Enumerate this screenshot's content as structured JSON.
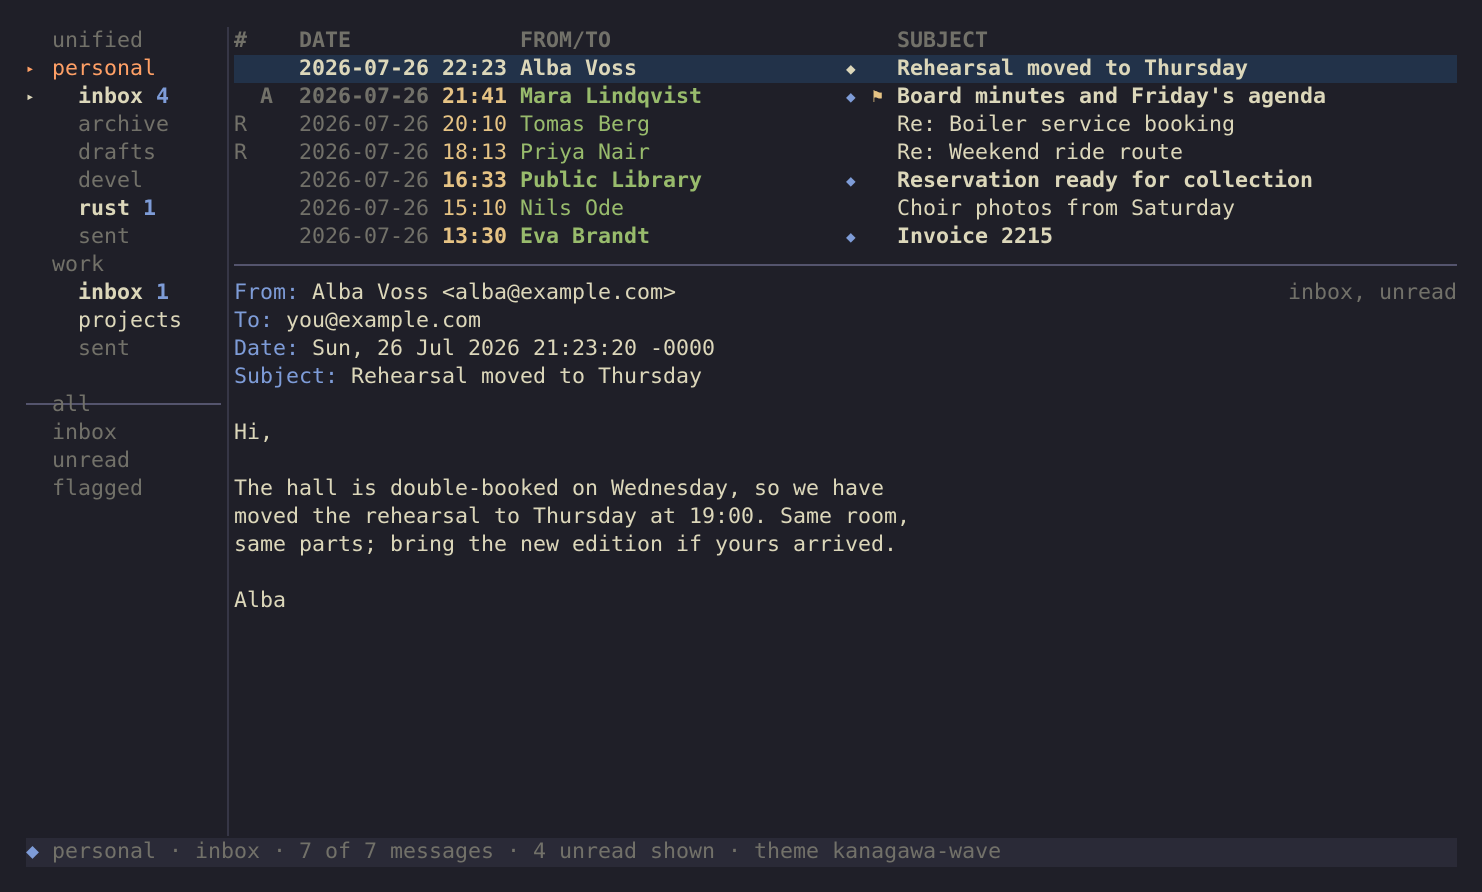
{
  "sidebar": {
    "unified": "unified",
    "accounts": [
      {
        "name": "personal",
        "arrow": "▸",
        "folders": [
          {
            "name": "inbox",
            "count": "4",
            "arrow": "▸"
          },
          {
            "name": "archive",
            "count": ""
          },
          {
            "name": "drafts",
            "count": ""
          },
          {
            "name": "devel",
            "count": ""
          },
          {
            "name": "rust",
            "count": "1"
          },
          {
            "name": "sent",
            "count": ""
          }
        ]
      },
      {
        "name": "work",
        "folders": [
          {
            "name": "inbox",
            "count": "1"
          },
          {
            "name": "projects",
            "count": ""
          },
          {
            "name": "sent",
            "count": ""
          }
        ]
      }
    ],
    "views": [
      "all",
      "inbox",
      "unread",
      "flagged"
    ]
  },
  "list": {
    "headers": {
      "num": "#",
      "date": "DATE",
      "from": "FROM/TO",
      "subject": "SUBJECT"
    },
    "rows": [
      {
        "mark": "",
        "date": "2026-07-26",
        "time": "22:23",
        "from": "Alba Voss",
        "unread_icon": "◆",
        "flag_icon": "",
        "subject": "Rehearsal moved to Thursday"
      },
      {
        "mark": "A",
        "date": "2026-07-26",
        "time": "21:41",
        "from": "Mara Lindqvist",
        "unread_icon": "◆",
        "flag_icon": "⚑",
        "subject": "Board minutes and Friday's agenda"
      },
      {
        "mark": "R",
        "date": "2026-07-26",
        "time": "20:10",
        "from": "Tomas Berg",
        "unread_icon": "",
        "flag_icon": "",
        "subject": "Re: Boiler service booking"
      },
      {
        "mark": "R",
        "date": "2026-07-26",
        "time": "18:13",
        "from": "Priya Nair",
        "unread_icon": "",
        "flag_icon": "",
        "subject": "Re: Weekend ride route"
      },
      {
        "mark": "",
        "date": "2026-07-26",
        "time": "16:33",
        "from": "Public Library",
        "unread_icon": "◆",
        "flag_icon": "",
        "subject": "Reservation ready for collection"
      },
      {
        "mark": "",
        "date": "2026-07-26",
        "time": "15:10",
        "from": "Nils Ode",
        "unread_icon": "",
        "flag_icon": "",
        "subject": "Choir photos from Saturday"
      },
      {
        "mark": "",
        "date": "2026-07-26",
        "time": "13:30",
        "from": "Eva Brandt",
        "unread_icon": "◆",
        "flag_icon": "",
        "subject": "Invoice 2215"
      }
    ]
  },
  "preview": {
    "tags": "inbox, unread",
    "from_label": "From:",
    "from": "Alba Voss <alba@example.com>",
    "to_label": "To:",
    "to": "you@example.com",
    "date_label": "Date:",
    "date": "Sun, 26 Jul 2026 21:23:20 -0000",
    "subject_label": "Subject:",
    "subject": "Rehearsal moved to Thursday",
    "body": [
      "",
      "Hi,",
      "",
      "The hall is double-booked on Wednesday, so we have",
      "moved the rehearsal to Thursday at 19:00. Same room,",
      "same parts; bring the new edition if yours arrived.",
      "",
      "Alba"
    ]
  },
  "status": {
    "icon": "◆",
    "text": "personal · inbox · 7 of 7 messages · 4 unread shown · theme kanagawa-wave"
  },
  "colors": {
    "background": "#1f1f28",
    "selected_row": "#223249",
    "accent_blue": "#7e9cd8",
    "accent_orange": "#ffa066",
    "sender_green": "#98bb6c",
    "time_yellow": "#e6c384",
    "dim_text": "#727169"
  }
}
